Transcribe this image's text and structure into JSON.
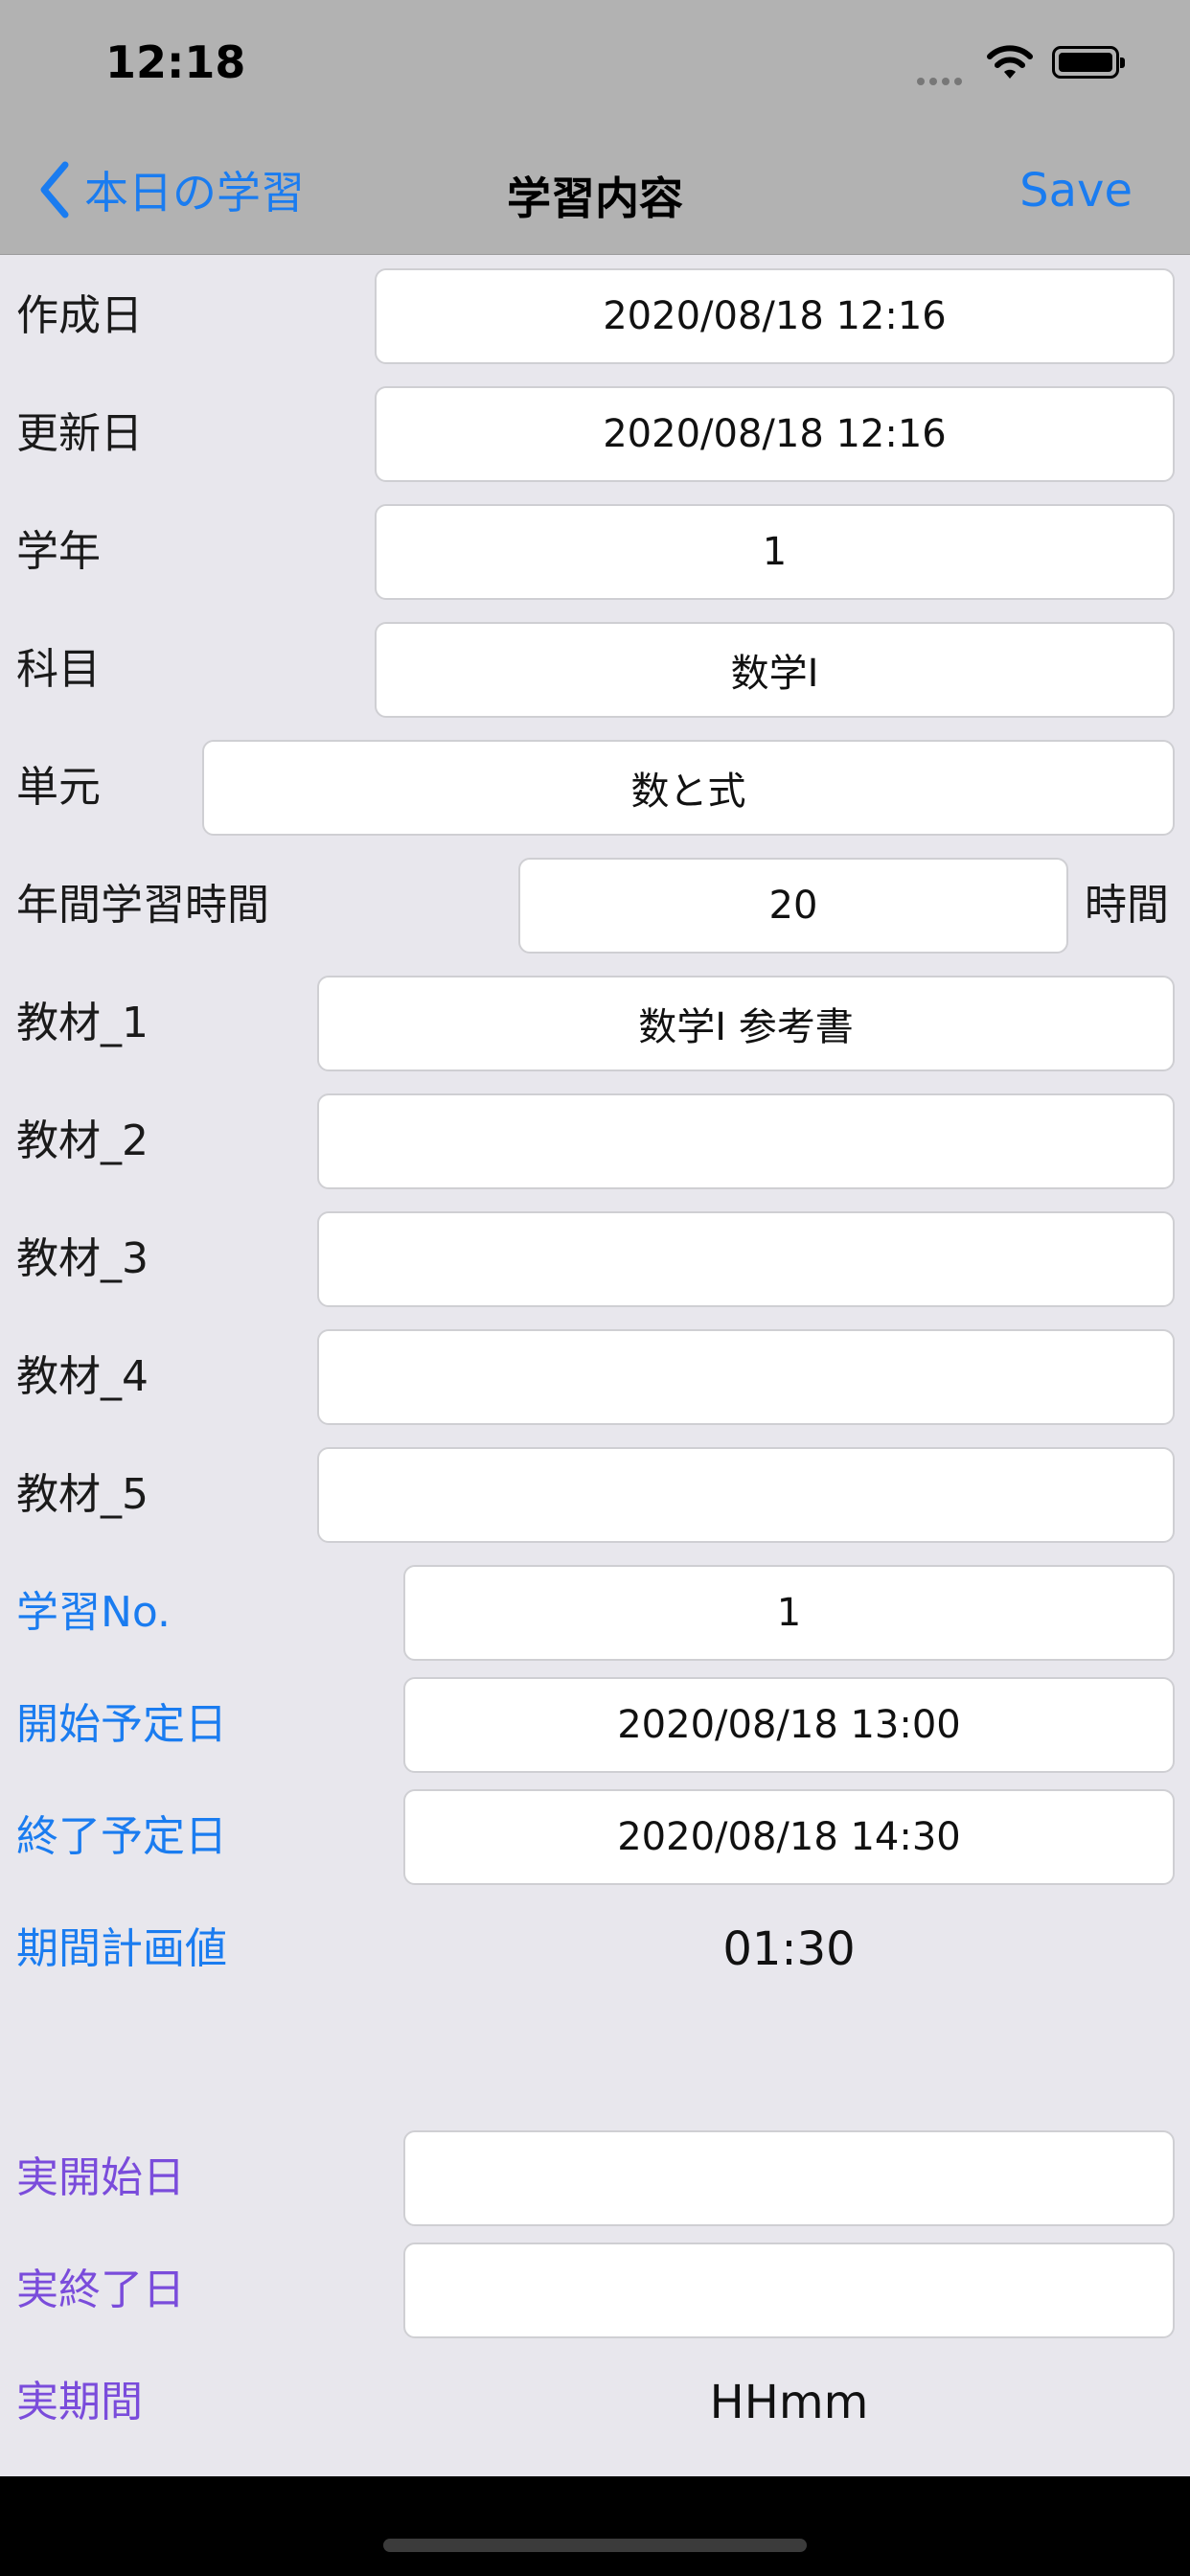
{
  "status_bar": {
    "time": "12:18"
  },
  "nav": {
    "back_label": "本日の学習",
    "title": "学習内容",
    "save_label": "Save"
  },
  "form": {
    "created": {
      "label": "作成日",
      "value": "2020/08/18 12:16"
    },
    "updated": {
      "label": "更新日",
      "value": "2020/08/18 12:16"
    },
    "grade": {
      "label": "学年",
      "value": "1"
    },
    "subject": {
      "label": "科目",
      "value": "数学I"
    },
    "unit": {
      "label": "単元",
      "value": "数と式"
    },
    "annual_hours": {
      "label": "年間学習時間",
      "value": "20",
      "suffix": "時間"
    },
    "material_1": {
      "label": "教材_1",
      "value": "数学I 参考書"
    },
    "material_2": {
      "label": "教材_2",
      "value": ""
    },
    "material_3": {
      "label": "教材_3",
      "value": ""
    },
    "material_4": {
      "label": "教材_4",
      "value": ""
    },
    "material_5": {
      "label": "教材_5",
      "value": ""
    },
    "study_no": {
      "label": "学習No.",
      "value": "1"
    },
    "planned_start": {
      "label": "開始予定日",
      "value": "2020/08/18 13:00"
    },
    "planned_end": {
      "label": "終了予定日",
      "value": "2020/08/18 14:30"
    },
    "planned_duration": {
      "label": "期間計画値",
      "value": "01:30"
    },
    "actual_start": {
      "label": "実開始日",
      "value": ""
    },
    "actual_end": {
      "label": "実終了日",
      "value": ""
    },
    "actual_duration": {
      "label": "実期間",
      "value": "HHmm"
    }
  },
  "colors": {
    "accent": "#1a7cf0",
    "plan_label": "#1a7cf0",
    "actual_label": "#7a4cdb",
    "background": "#e8e7ed",
    "bar": "#b2b2b2"
  },
  "icons": {
    "back": "chevron-left-icon",
    "wifi": "wifi-icon",
    "battery": "battery-icon",
    "signal": "cellular-signal-icon"
  }
}
